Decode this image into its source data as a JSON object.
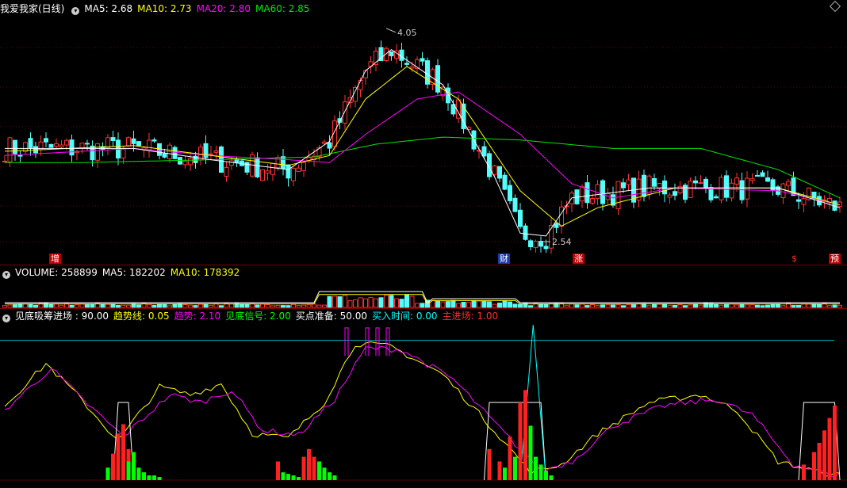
{
  "main_panel": {
    "title": "我爱我家(日线)",
    "ma5_label": "MA5: 2.68",
    "ma10_label": "MA10: 2.73",
    "ma20_label": "MA20: 2.80",
    "ma60_label": "MA60: 2.85",
    "high_label": "4.05",
    "low_label": "2.54",
    "markers": [
      "增",
      "财",
      "涨",
      "$",
      "预"
    ]
  },
  "volume_panel": {
    "title": "VOLUME: 258899",
    "ma5_label": "MA5: 182202",
    "ma10_label": "MA10: 178392"
  },
  "indicator_panel": {
    "title": "见底吸筹进场 : 90.00",
    "trend_line_label": "趋势线: 0.05",
    "trend_label": "趋势: 2.10",
    "bottom_signal_label": "见底信号: 2.00",
    "buy_prep_label": "买点准备: 50.00",
    "buy_time_label": "买入时间: 0.00",
    "main_entry_label": "主进场: 1.00"
  },
  "colors": {
    "up": "#ff3232",
    "down": "#54fcfc",
    "ma5": "#ffffff",
    "ma10": "#ffff00",
    "ma20": "#ff00ff",
    "ma60": "#00e600",
    "separator": "#7a0000",
    "green_bar": "#00ff00",
    "threshold_line": "#00b4b4"
  },
  "chart_data": {
    "type": "candlestick",
    "price_axis_range": [
      2.4,
      4.15
    ],
    "extremes": {
      "high": 4.05,
      "low": 2.54
    },
    "ma_keypoints": {
      "ma5": [
        [
          0,
          3.2
        ],
        [
          25,
          3.2
        ],
        [
          40,
          3.12
        ],
        [
          55,
          3.05
        ],
        [
          63,
          3.25
        ],
        [
          70,
          3.75
        ],
        [
          75,
          3.9
        ],
        [
          85,
          3.65
        ],
        [
          95,
          3.0
        ],
        [
          100,
          2.6
        ],
        [
          105,
          2.58
        ],
        [
          110,
          2.85
        ],
        [
          125,
          2.92
        ],
        [
          150,
          2.92
        ],
        [
          162,
          2.78
        ]
      ],
      "ma10": [
        [
          0,
          3.18
        ],
        [
          25,
          3.22
        ],
        [
          40,
          3.15
        ],
        [
          55,
          3.08
        ],
        [
          63,
          3.15
        ],
        [
          70,
          3.55
        ],
        [
          78,
          3.78
        ],
        [
          88,
          3.55
        ],
        [
          100,
          2.9
        ],
        [
          108,
          2.65
        ],
        [
          115,
          2.78
        ],
        [
          130,
          2.92
        ],
        [
          150,
          2.92
        ],
        [
          162,
          2.8
        ]
      ],
      "ma20": [
        [
          0,
          3.15
        ],
        [
          25,
          3.2
        ],
        [
          40,
          3.15
        ],
        [
          55,
          3.12
        ],
        [
          63,
          3.1
        ],
        [
          70,
          3.3
        ],
        [
          80,
          3.55
        ],
        [
          88,
          3.6
        ],
        [
          100,
          3.3
        ],
        [
          110,
          2.95
        ],
        [
          118,
          2.85
        ],
        [
          130,
          2.92
        ],
        [
          150,
          2.9
        ],
        [
          162,
          2.8
        ]
      ],
      "ma60": [
        [
          0,
          3.1
        ],
        [
          15,
          3.1
        ],
        [
          40,
          3.12
        ],
        [
          60,
          3.14
        ],
        [
          72,
          3.23
        ],
        [
          85,
          3.28
        ],
        [
          100,
          3.26
        ],
        [
          118,
          3.2
        ],
        [
          135,
          3.2
        ],
        [
          150,
          3.05
        ],
        [
          162,
          2.85
        ]
      ]
    },
    "indicator_range": [
      0,
      100
    ],
    "threshold": 90
  }
}
